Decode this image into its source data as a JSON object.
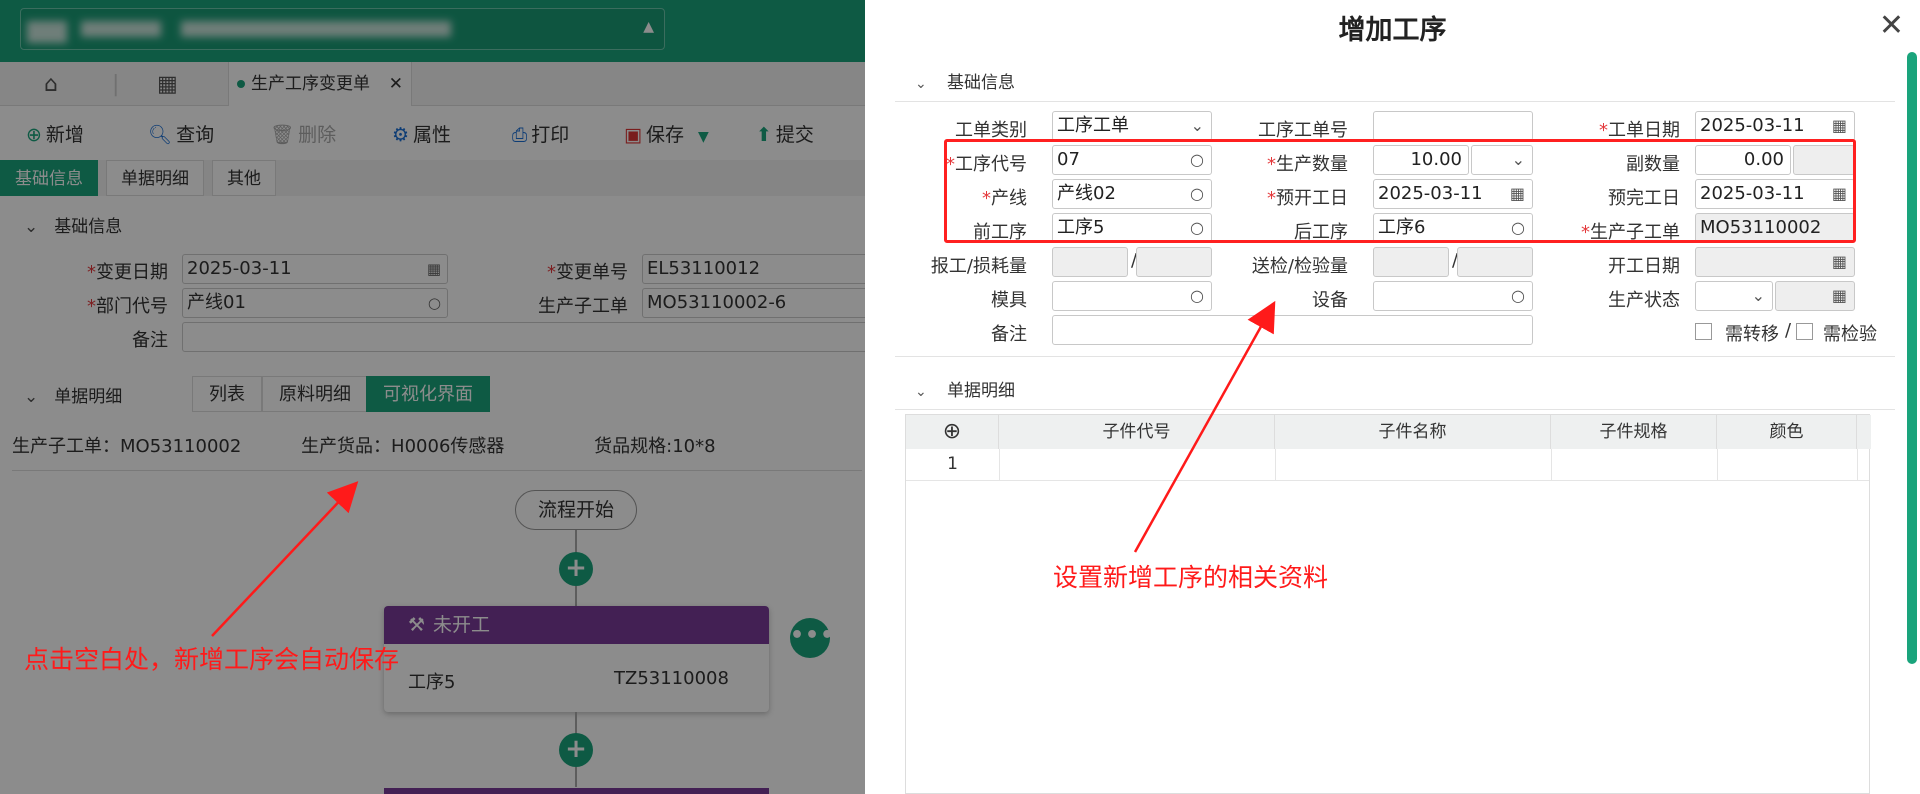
{
  "background_app": {
    "tab_label": "生产工序变更单",
    "toolbar": {
      "add": "新增",
      "query": "查询",
      "delete": "删除",
      "properties": "属性",
      "print": "打印",
      "save": "保存",
      "submit": "提交"
    },
    "sub_tabs": [
      "基础信息",
      "单据明细",
      "其他"
    ],
    "basic_section_title": "基础信息",
    "fields": {
      "change_date_label": "变更日期",
      "change_date_value": "2025-03-11",
      "change_no_label": "变更单号",
      "change_no_value": "EL53110012",
      "dept_label": "部门代号",
      "dept_value": "产线01",
      "sub_order_label": "生产子工单",
      "sub_order_value": "MO53110002-6",
      "remark_label": "备注"
    },
    "detail_section_title": "单据明细",
    "detail_views": [
      "列表",
      "原料明细",
      "可视化界面"
    ],
    "info_line": {
      "sub_order": "生产子工单：MO53110002",
      "goods": "生产货品：H0006传感器",
      "spec": "货品规格:10*8"
    },
    "flow": {
      "start_label": "流程开始",
      "card_status": "未开工",
      "card_process": "工序5",
      "card_code": "TZ53110008"
    }
  },
  "annotations": {
    "left": "点击空白处，新增工序会自动保存",
    "right": "设置新增工序的相关资料"
  },
  "dialog": {
    "title": "增加工序",
    "basic_section_title": "基础信息",
    "detail_section_title": "单据明细",
    "labels": {
      "order_type": "工单类别",
      "process_order_no": "工序工单号",
      "order_date": "工单日期",
      "process_code": "工序代号",
      "quantity": "生产数量",
      "sub_quantity": "副数量",
      "line": "产线",
      "planned_start": "预开工日",
      "planned_end": "预完工日",
      "prev_process": "前工序",
      "next_process": "后工序",
      "sub_order": "生产子工单",
      "report_loss": "报工/损耗量",
      "send_inspect": "送检/检验量",
      "start_date": "开工日期",
      "mold": "模具",
      "equipment": "设备",
      "prod_status": "生产状态",
      "remark": "备注",
      "need_transfer": "需转移",
      "need_inspect": "需检验"
    },
    "values": {
      "order_type": "工序工单",
      "order_date": "2025-03-11",
      "process_code": "07",
      "quantity": "10.00",
      "sub_quantity": "0.00",
      "line": "产线02",
      "planned_start": "2025-03-11",
      "planned_end": "2025-03-11",
      "prev_process": "工序5",
      "next_process": "工序6",
      "sub_order": "MO53110002"
    },
    "grid": {
      "columns": [
        "子件代号",
        "子件名称",
        "子件规格",
        "颜色"
      ],
      "rows": [
        {
          "index": "1"
        }
      ]
    }
  }
}
